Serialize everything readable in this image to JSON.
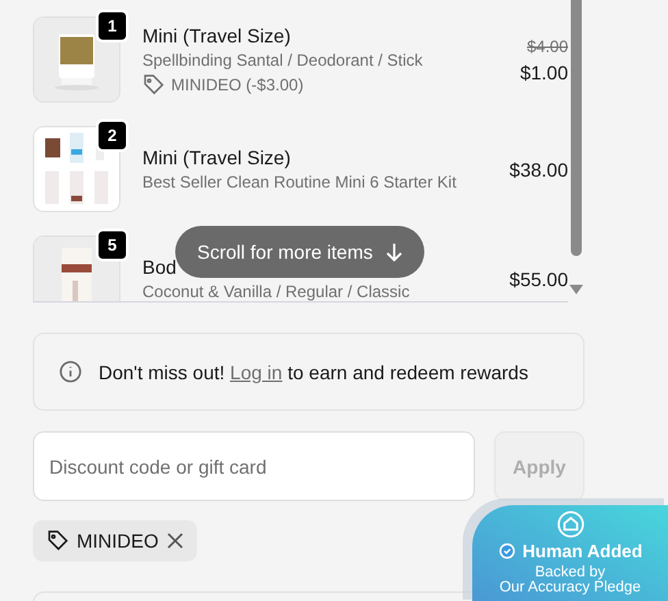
{
  "cart_items": [
    {
      "quantity": "1",
      "title": "Mini (Travel Size)",
      "variant": "Spellbinding Santal / Deodorant / Stick",
      "discount": "MINIDEO (-$3.00)",
      "original_price": "$4.00",
      "price": "$1.00"
    },
    {
      "quantity": "2",
      "title": "Mini (Travel Size)",
      "variant": "Best Seller Clean Routine Mini 6 Starter Kit",
      "price": "$38.00"
    },
    {
      "quantity": "5",
      "title": "Bod",
      "variant": "Coconut & Vanilla / Regular / Classic",
      "price": "$55.00"
    }
  ],
  "scroll_hint": {
    "label": "Scroll for more items"
  },
  "rewards_notice": {
    "before": "Don't miss out!",
    "link": "Log in",
    "after": "to earn and redeem rewards"
  },
  "discount_field": {
    "placeholder": "Discount code or gift card"
  },
  "apply_button": {
    "label": "Apply"
  },
  "applied_codes": [
    {
      "code": "MINIDEO"
    }
  ],
  "trust_badge": {
    "title": "Human Added",
    "line_1": "Backed by",
    "line_2": "Our Accuracy Pledge"
  }
}
